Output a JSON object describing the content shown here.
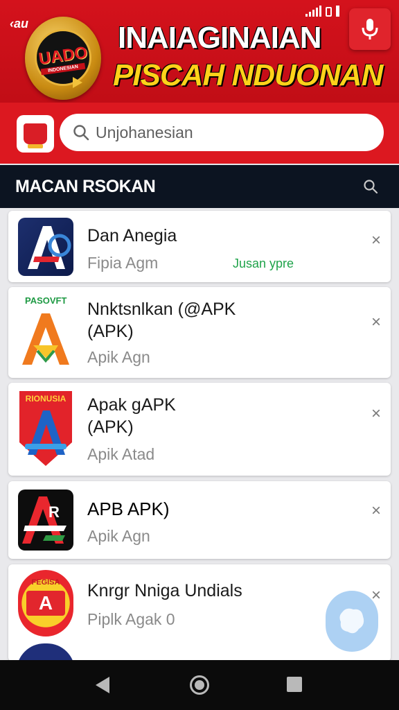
{
  "header": {
    "back_label": "‹au",
    "badge_title": "UADO",
    "badge_subtitle": "INDONESIAN",
    "title_line1": "INAIAGINAIAN",
    "title_line2": "PISCAH NDUONAN",
    "mic_icon": "microphone-icon",
    "colors": {
      "banner": "#d4121c",
      "title2": "#ffd21a"
    }
  },
  "search": {
    "placeholder": "Unjohanesian",
    "icon": "search-icon"
  },
  "section": {
    "label": "MACAN RSOKAN",
    "icon": "search-icon"
  },
  "apps": [
    {
      "title_lines": [
        "Dan Anegia"
      ],
      "sub": "Fipia Agm",
      "extra": "Jusan ypre"
    },
    {
      "title_lines": [
        "Nnktsnlkan (@APK",
        "(APK)"
      ],
      "sub": "Apik Agn",
      "icon_tag": "PASOVFT"
    },
    {
      "title_lines": [
        "Apak gAPK",
        "(APK)"
      ],
      "sub": "Apik Atad",
      "icon_tag": "RIONUSIA"
    },
    {
      "title_lines": [
        "APB APK)"
      ],
      "sub": "Apik Agn"
    },
    {
      "title_lines": [
        "Knrgr Nniga Undials"
      ],
      "sub": "Piplk Agak 0",
      "icon_tag": "FEGISA"
    }
  ],
  "navbar": {
    "back": "back-icon",
    "home": "home-icon",
    "recents": "recents-icon"
  }
}
